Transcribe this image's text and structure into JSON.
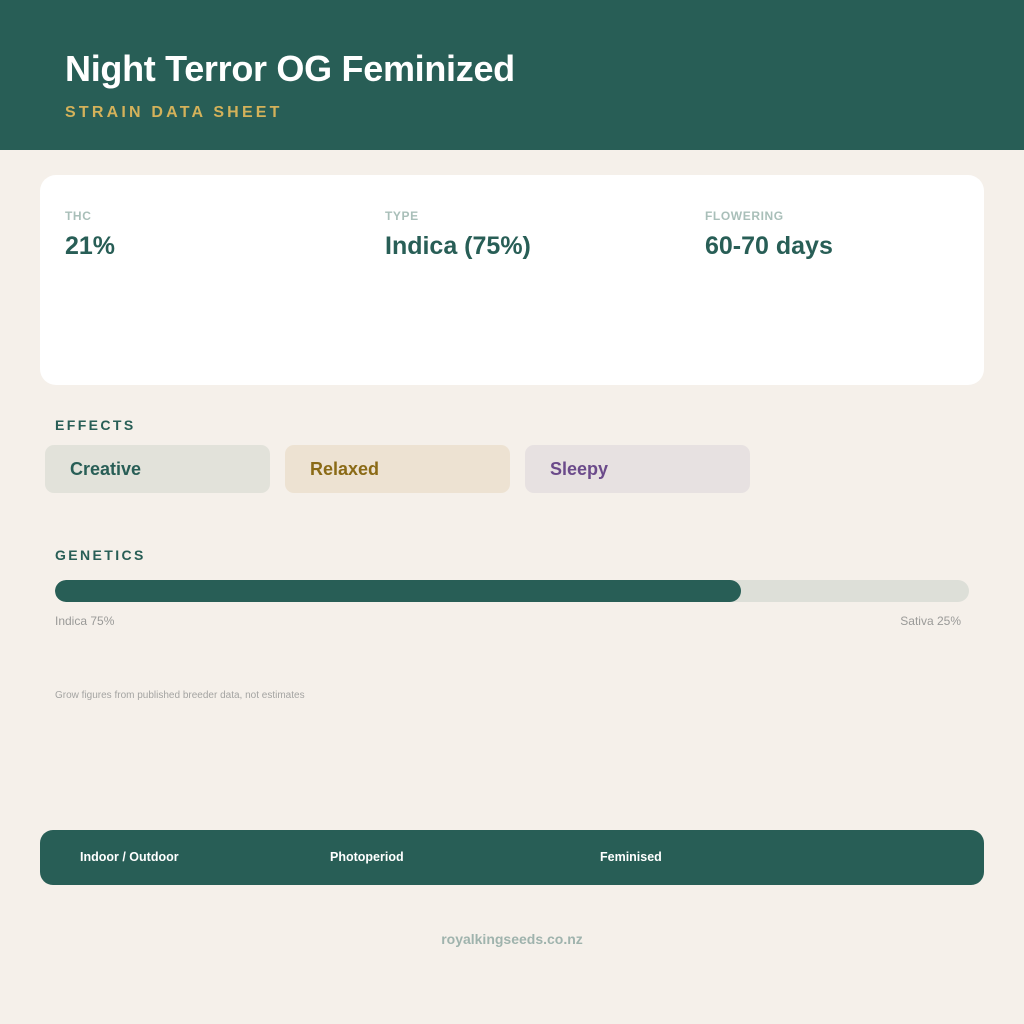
{
  "header": {
    "title": "Night Terror OG Feminized",
    "subtitle": "STRAIN DATA SHEET"
  },
  "stats": [
    {
      "label": "THC",
      "value": "21%"
    },
    {
      "label": "TYPE",
      "value": "Indica (75%)"
    },
    {
      "label": "FLOWERING",
      "value": "60-70 days"
    }
  ],
  "effects": {
    "label": "EFFECTS",
    "items": [
      {
        "name": "Creative",
        "color": "#285e56",
        "bg": "#e2e2da"
      },
      {
        "name": "Relaxed",
        "color": "#8a6a16",
        "bg": "#ede2d2"
      },
      {
        "name": "Sleepy",
        "color": "#6b4a8a",
        "bg": "#e7e1e1"
      }
    ]
  },
  "genetics": {
    "label": "GENETICS",
    "indica_percent": 75,
    "indica_label": "Indica 75%",
    "sativa_label": "Sativa 25%"
  },
  "note": "Grow figures from published breeder data, not estimates",
  "footer": {
    "items": [
      "Indoor / Outdoor",
      "Photoperiod",
      "Feminised"
    ]
  },
  "site": "royalkingseeds.co.nz",
  "colors": {
    "primary": "#285e56",
    "accent": "#d4b25a",
    "background": "#f5f0ea"
  }
}
